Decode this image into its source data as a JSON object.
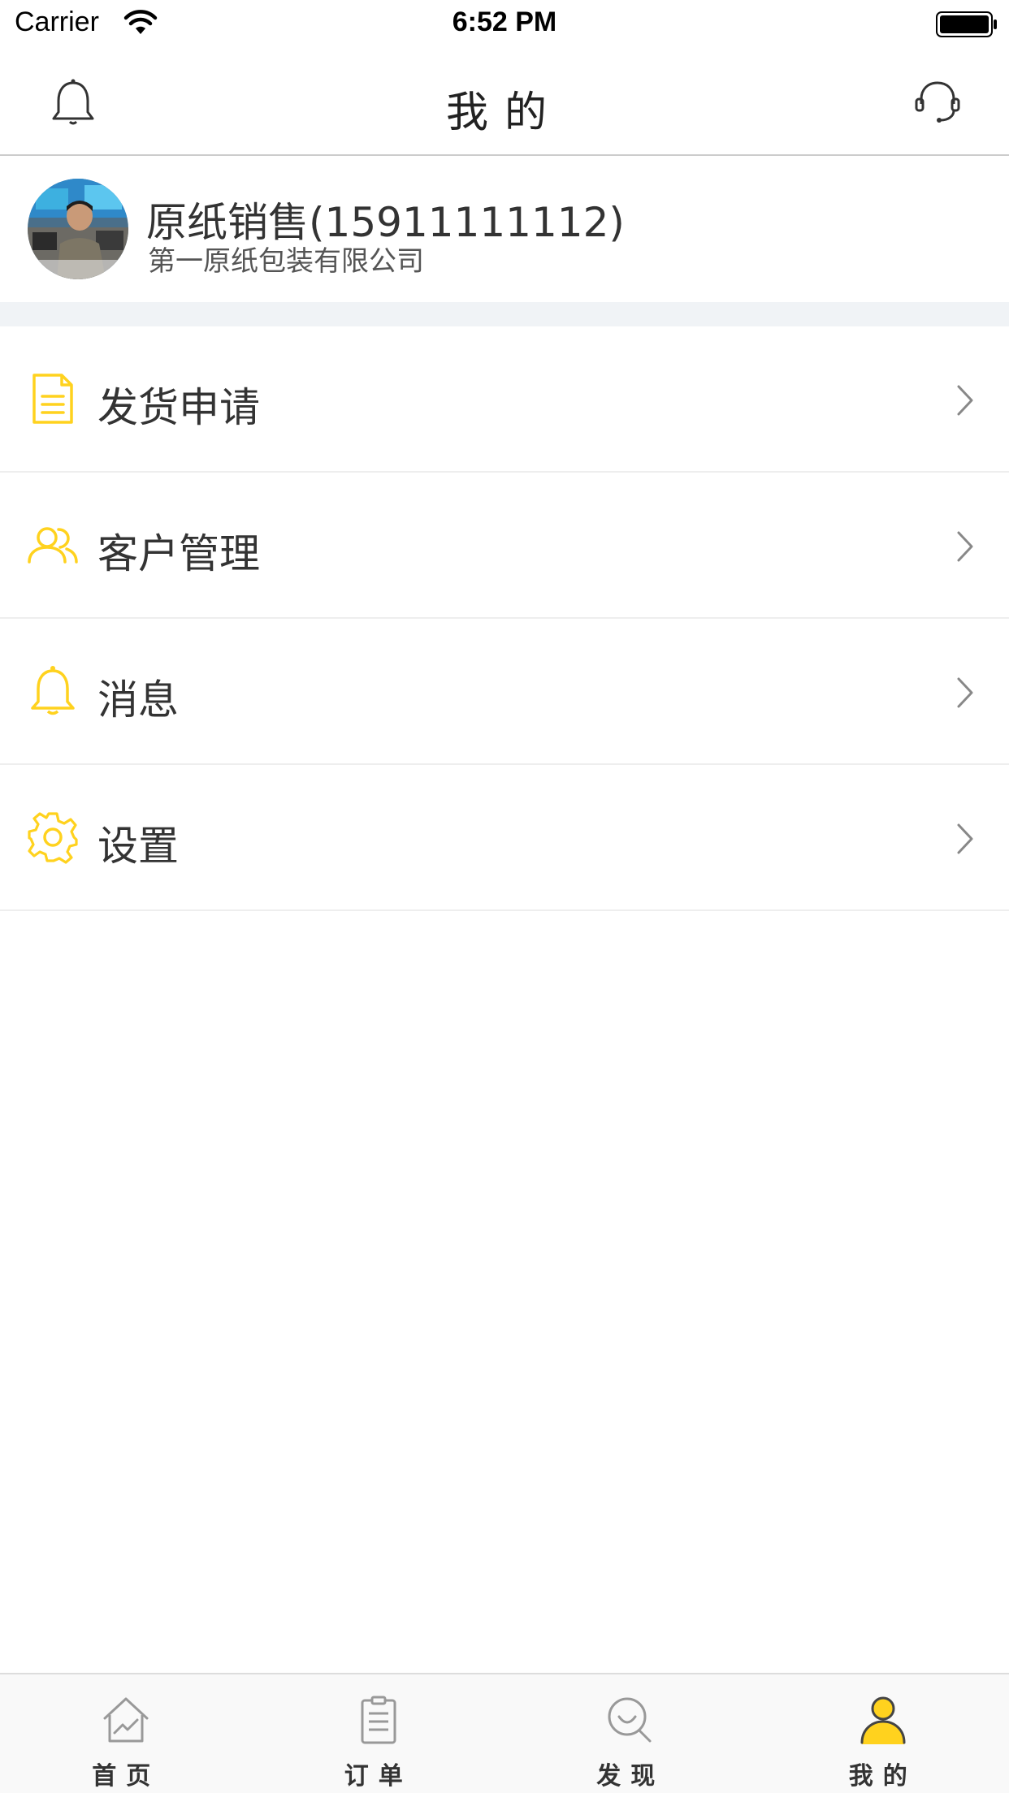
{
  "status_bar": {
    "carrier": "Carrier",
    "time": "6:52 PM"
  },
  "nav": {
    "title": "我的",
    "left_icon": "bell-icon",
    "right_icon": "headset-icon"
  },
  "profile": {
    "name": "原纸销售(15911111112)",
    "company": "第一原纸包装有限公司"
  },
  "menu": {
    "items": [
      {
        "label": "发货申请",
        "icon": "document-icon"
      },
      {
        "label": "客户管理",
        "icon": "users-icon"
      },
      {
        "label": "消息",
        "icon": "bell-icon"
      },
      {
        "label": "设置",
        "icon": "gear-icon"
      }
    ]
  },
  "tabs": [
    {
      "label": "首页",
      "icon": "home-chart-icon"
    },
    {
      "label": "订单",
      "icon": "clipboard-icon"
    },
    {
      "label": "发现",
      "icon": "search-icon"
    },
    {
      "label": "我的",
      "icon": "person-icon",
      "active": true
    }
  ],
  "colors": {
    "accent": "#FFD21E",
    "text": "#333333",
    "divider": "#EEEEEE",
    "section_bg": "#F0F3F6"
  }
}
